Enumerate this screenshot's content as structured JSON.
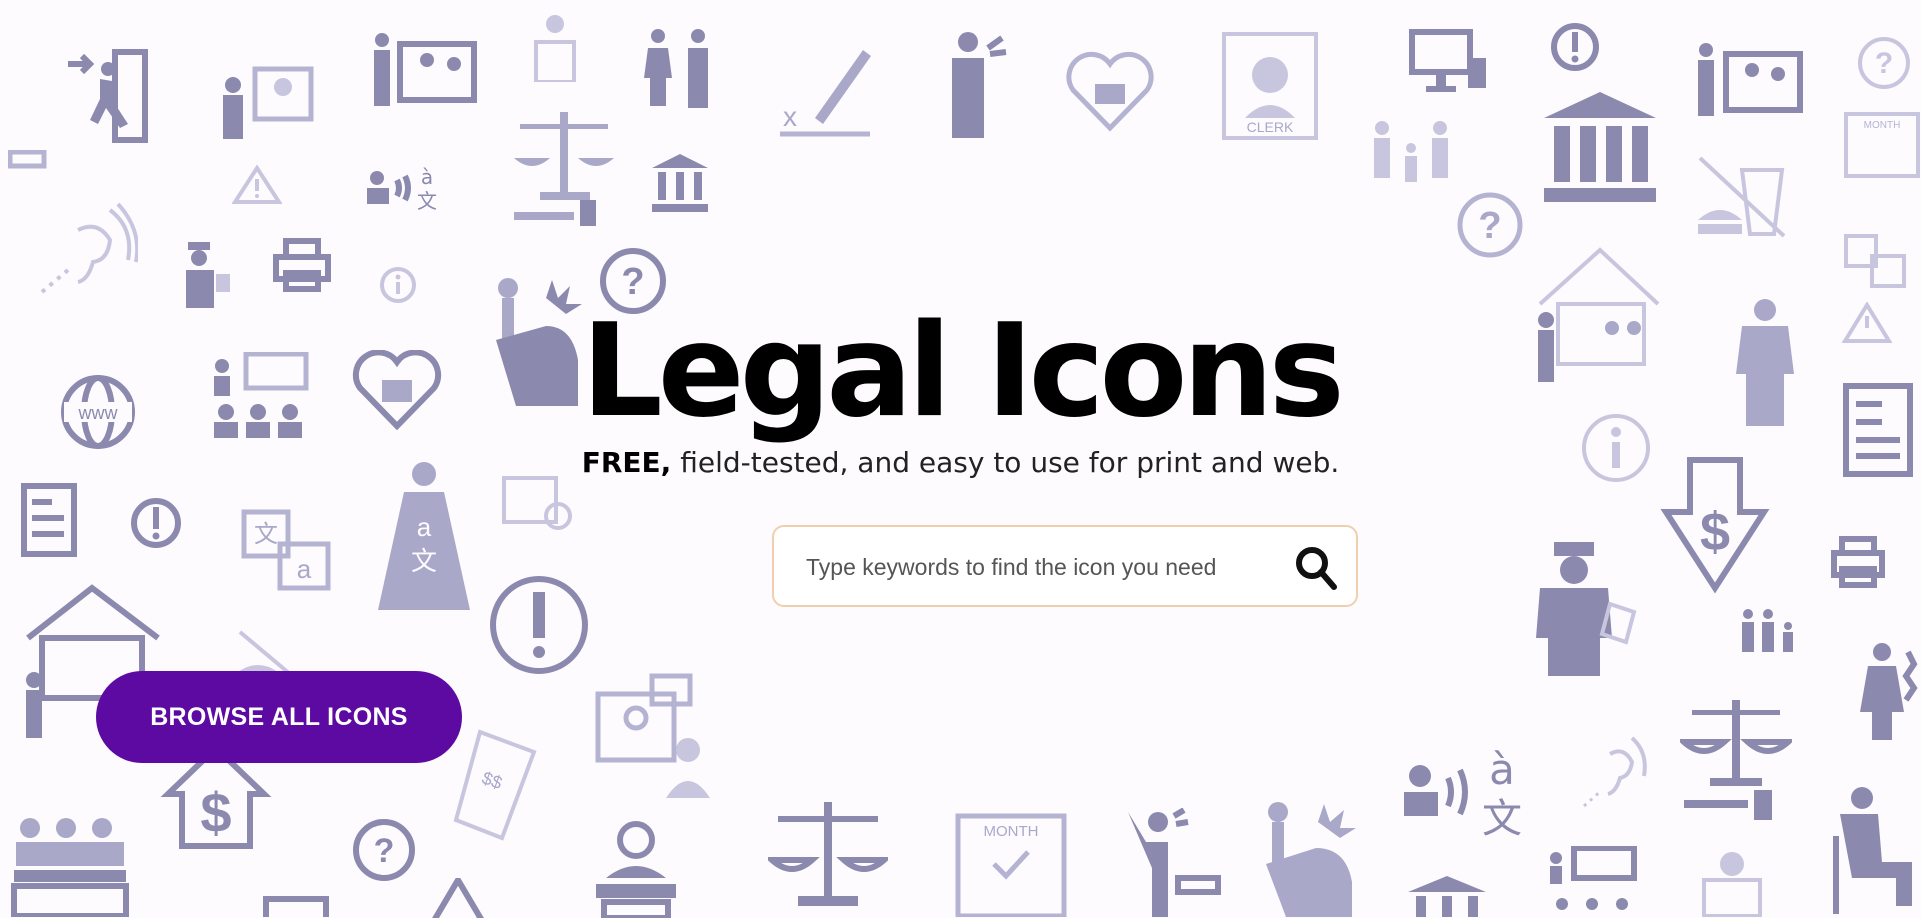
{
  "hero": {
    "title": "Legal Icons",
    "subtitle_bold": "FREE,",
    "subtitle_rest": " field-tested, and easy to use for print and web."
  },
  "search": {
    "placeholder": "Type keywords to find the icon you need",
    "value": ""
  },
  "browse_button": {
    "label": "BROWSE ALL ICONS"
  },
  "background_icons": {
    "clerk_label": "CLERK",
    "month_label": "MONTH",
    "www_label": "www",
    "money_label": "$$",
    "translate_target": "a",
    "translate_source": "文",
    "accent_glyph": "à"
  },
  "colors": {
    "accent": "#5c0aa2",
    "icon_dark": "#8b8aae",
    "icon_mid": "#a9a8c9",
    "icon_light": "#c8c6de",
    "search_border": "#f0cfae"
  }
}
